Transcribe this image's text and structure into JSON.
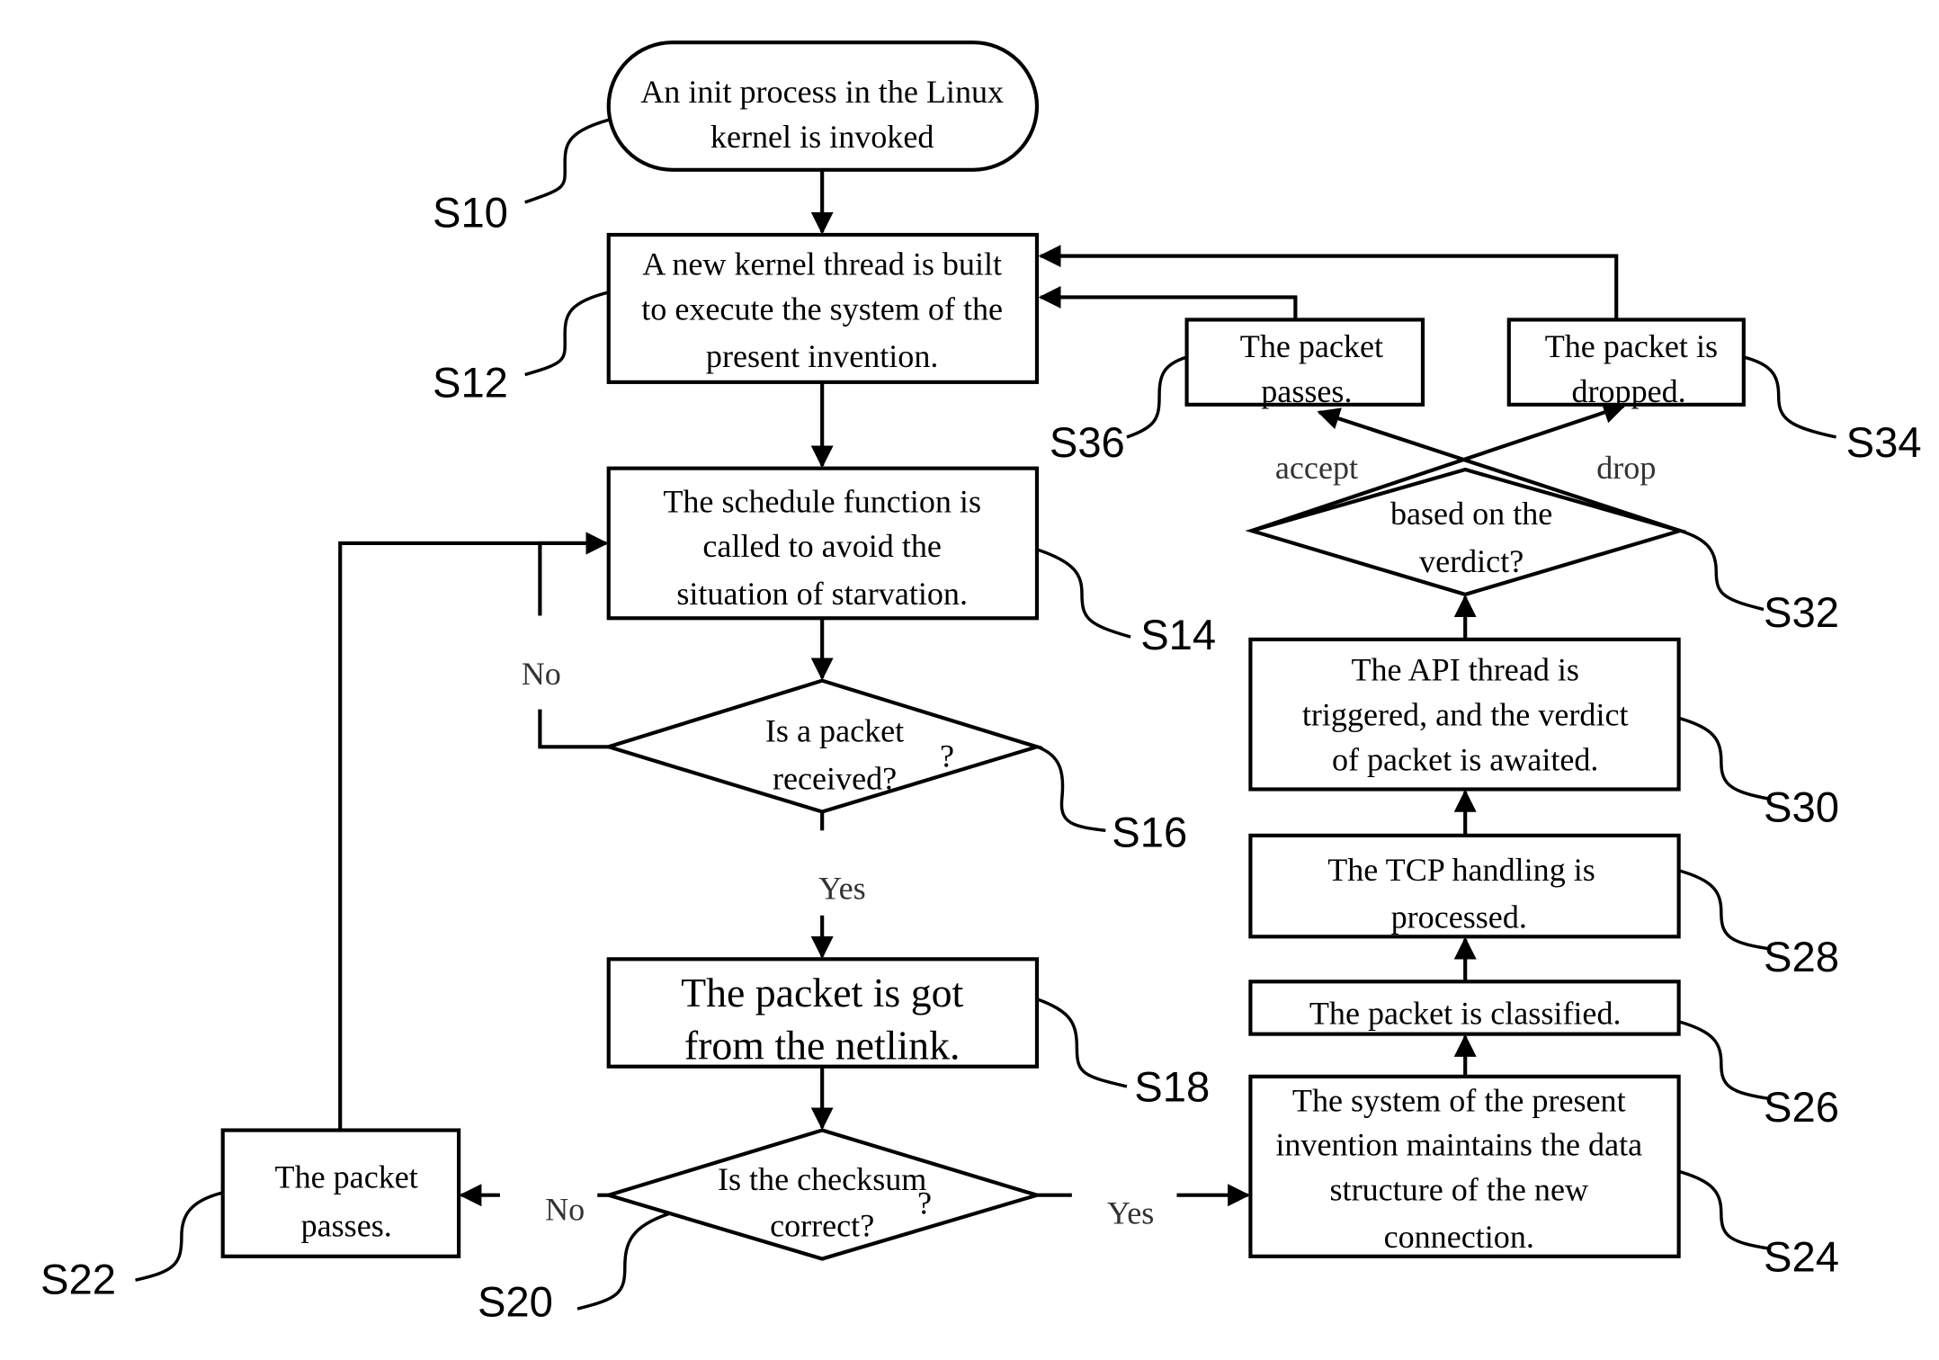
{
  "diagram": {
    "type": "flowchart",
    "nodes": {
      "s10": {
        "step": "S10",
        "shape": "terminal",
        "lines": [
          "An init process in the Linux",
          "kernel is invoked"
        ]
      },
      "s12": {
        "step": "S12",
        "shape": "process",
        "lines": [
          "A new kernel thread is built",
          "to execute the system of the",
          "present invention."
        ]
      },
      "s14": {
        "step": "S14",
        "shape": "process",
        "lines": [
          "The schedule function is",
          "called to avoid the",
          "situation of starvation."
        ]
      },
      "s16": {
        "step": "S16",
        "shape": "decision",
        "lines": [
          "Is a packet",
          "received?"
        ],
        "extra": "?"
      },
      "s18": {
        "step": "S18",
        "shape": "process",
        "lines": [
          "The packet is got",
          "from the netlink."
        ]
      },
      "s20": {
        "step": "S20",
        "shape": "decision",
        "lines": [
          "Is the checksum",
          "correct?"
        ],
        "extra": "?"
      },
      "s22": {
        "step": "S22",
        "shape": "process",
        "lines": [
          "The packet",
          "passes."
        ]
      },
      "s24": {
        "step": "S24",
        "shape": "process",
        "lines": [
          "The system of the present",
          "invention maintains the data",
          "structure of the new",
          "connection."
        ]
      },
      "s26": {
        "step": "S26",
        "shape": "process",
        "lines": [
          "The packet is classified."
        ]
      },
      "s28": {
        "step": "S28",
        "shape": "process",
        "lines": [
          "The TCP handling is",
          "processed."
        ]
      },
      "s30": {
        "step": "S30",
        "shape": "process",
        "lines": [
          "The API thread is",
          "triggered, and the verdict",
          "of packet is awaited."
        ]
      },
      "s32": {
        "step": "S32",
        "shape": "decision",
        "lines": [
          "based on the",
          "verdict?"
        ]
      },
      "s34": {
        "step": "S34",
        "shape": "process",
        "lines": [
          "The packet is",
          "dropped."
        ]
      },
      "s36": {
        "step": "S36",
        "shape": "process",
        "lines": [
          "The packet",
          "passes."
        ]
      }
    },
    "edge_labels": {
      "s16_no": "No",
      "s16_yes": "Yes",
      "s20_no": "No",
      "s20_yes": "Yes",
      "s32_accept": "accept",
      "s32_drop": "drop"
    },
    "edges": [
      {
        "from": "S10",
        "to": "S12"
      },
      {
        "from": "S12",
        "to": "S14"
      },
      {
        "from": "S14",
        "to": "S16"
      },
      {
        "from": "S16",
        "to": "S14",
        "label": "No"
      },
      {
        "from": "S16",
        "to": "S18",
        "label": "Yes"
      },
      {
        "from": "S18",
        "to": "S20"
      },
      {
        "from": "S20",
        "to": "S22",
        "label": "No"
      },
      {
        "from": "S20",
        "to": "S24",
        "label": "Yes"
      },
      {
        "from": "S22",
        "to": "S14"
      },
      {
        "from": "S24",
        "to": "S26"
      },
      {
        "from": "S26",
        "to": "S28"
      },
      {
        "from": "S28",
        "to": "S30"
      },
      {
        "from": "S30",
        "to": "S32"
      },
      {
        "from": "S32",
        "to": "S36",
        "label": "accept"
      },
      {
        "from": "S32",
        "to": "S34",
        "label": "drop"
      },
      {
        "from": "S36",
        "to": "S12"
      },
      {
        "from": "S34",
        "to": "S12"
      }
    ]
  }
}
